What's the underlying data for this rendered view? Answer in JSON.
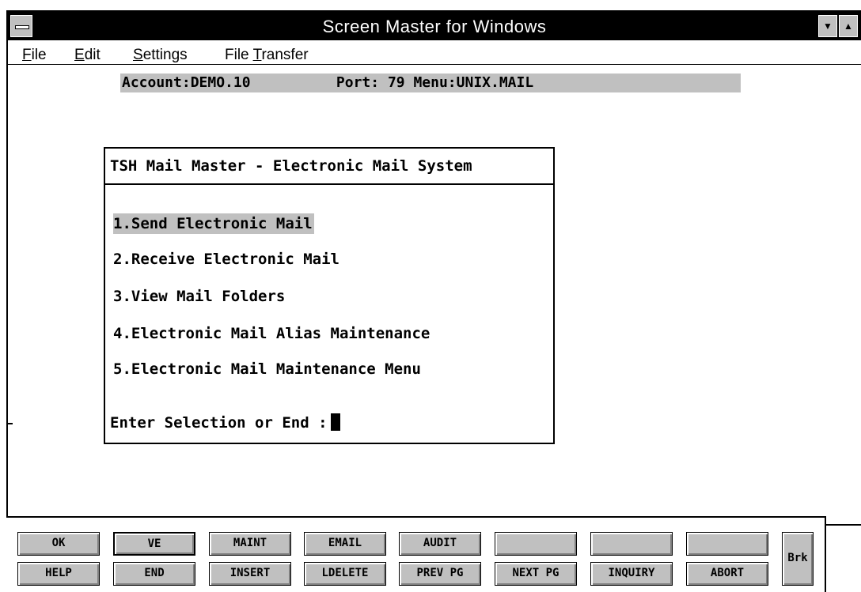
{
  "window": {
    "title": "Screen Master for Windows",
    "minimize_glyph": "▼",
    "maximize_glyph": "▲"
  },
  "menu": {
    "items": [
      {
        "pre": "",
        "ul": "F",
        "post": "ile"
      },
      {
        "pre": "",
        "ul": "E",
        "post": "dit"
      },
      {
        "pre": "",
        "ul": "S",
        "post": "ettings"
      },
      {
        "pre": "File ",
        "ul": "T",
        "post": "ransfer"
      }
    ]
  },
  "status": {
    "line": "Account:DEMO.10          Port: 79 Menu:UNIX.MAIL"
  },
  "dialog": {
    "title": "TSH Mail Master - Electronic Mail System",
    "options": [
      "1.Send Electronic Mail",
      "2.Receive Electronic Mail",
      "3.View Mail Folders",
      "4.Electronic Mail Alias Maintenance",
      "5.Electronic Mail Maintenance Menu"
    ],
    "selected_index": 0,
    "prompt": "Enter Selection or End :"
  },
  "function_keys": {
    "row1": [
      "OK",
      "VE",
      "MAINT",
      "EMAIL",
      "AUDIT",
      "",
      "",
      ""
    ],
    "row2": [
      "HELP",
      "END",
      "INSERT",
      "LDELETE",
      "PREV PG",
      "NEXT PG",
      "INQUIRY",
      "ABORT"
    ],
    "brk": "Brk"
  },
  "colors": {
    "title_bg": "#000000",
    "highlight": "#c0c0c0",
    "button_face": "#c0c0c0"
  }
}
